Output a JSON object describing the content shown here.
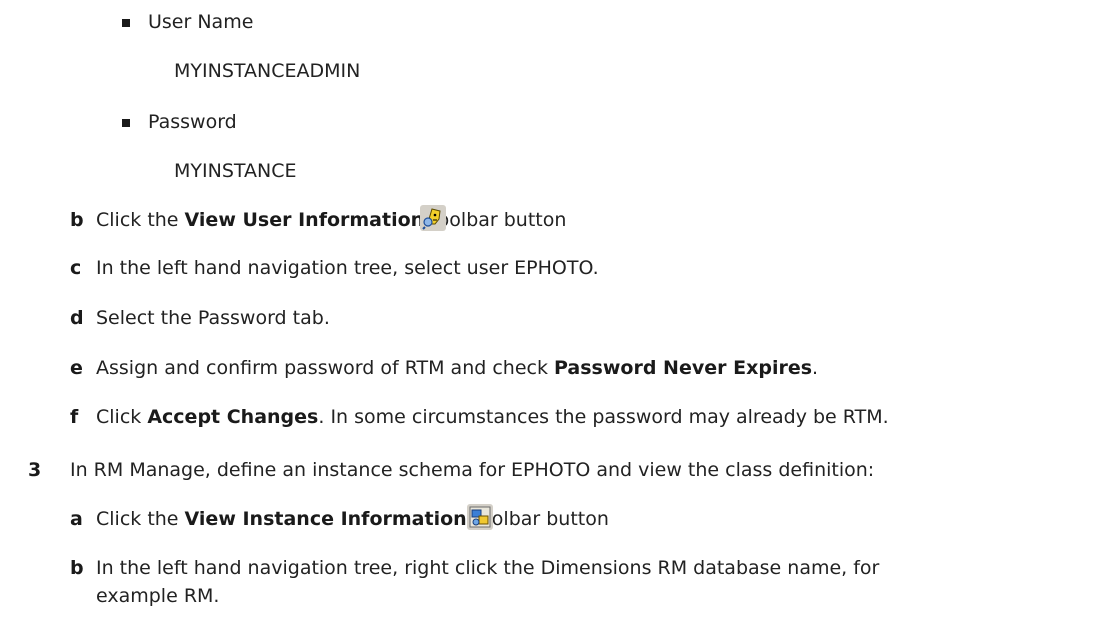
{
  "bullets": [
    {
      "label": "User Name",
      "value": "MYINSTANCEADMIN"
    },
    {
      "label": "Password",
      "value": "MYINSTANCE"
    }
  ],
  "steps_2": [
    {
      "letter": "b",
      "pre": "Click the ",
      "bold": "View User Information",
      "post": " toolbar button",
      "icon": "view-user-information-icon"
    },
    {
      "letter": "c",
      "text": "In the left hand navigation tree, select user EPHOTO."
    },
    {
      "letter": "d",
      "text": "Select the Password tab."
    },
    {
      "letter": "e",
      "pre": "Assign and confirm password of RTM and check ",
      "bold": "Password Never Expires",
      "post": "."
    },
    {
      "letter": "f",
      "pre": "Click ",
      "bold": "Accept Changes",
      "post": ". In some circumstances the password may already be RTM."
    }
  ],
  "step_3": {
    "number": "3",
    "text": "In RM Manage, define an instance schema for EPHOTO and view the class definition:",
    "substeps": [
      {
        "letter": "a",
        "pre": "Click the ",
        "bold": "View Instance Information",
        "post": " toolbar button",
        "icon": "view-instance-information-icon"
      },
      {
        "letter": "b",
        "line1": "In the left hand navigation tree, right click the Dimensions RM database name, for",
        "line2": "example RM."
      }
    ]
  },
  "colors": {
    "text": "#222222",
    "bullet": "#1a1a1a",
    "icon_bg": "#d4d0c8"
  }
}
